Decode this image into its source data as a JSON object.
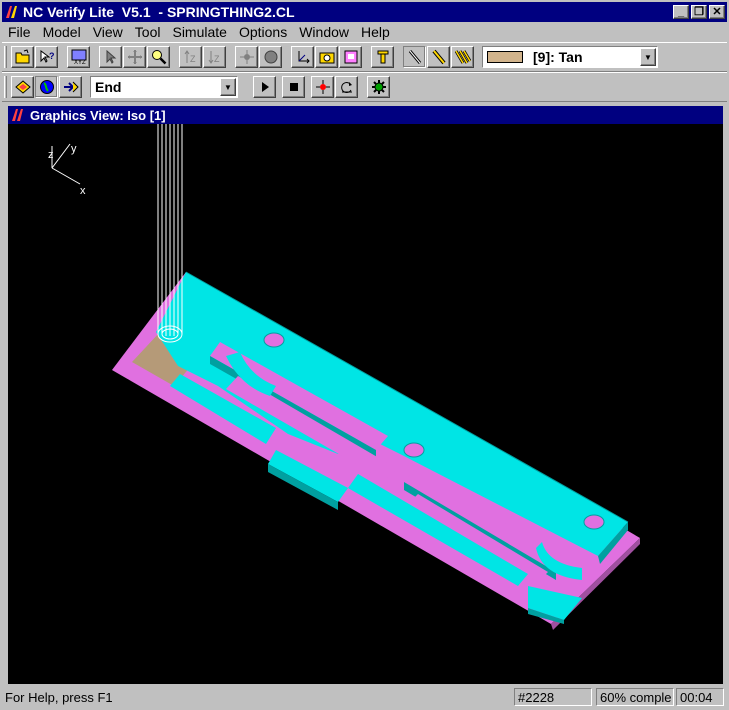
{
  "window": {
    "title": "NC Verify Lite  V5.1  - SPRINGTHING2.CL",
    "minimize": "_",
    "restore": "❐",
    "close": "✕"
  },
  "menu": [
    {
      "label": "File"
    },
    {
      "label": "Model"
    },
    {
      "label": "View"
    },
    {
      "label": "Tool"
    },
    {
      "label": "Simulate"
    },
    {
      "label": "Options"
    },
    {
      "label": "Window"
    },
    {
      "label": "Help"
    }
  ],
  "toolbar1": {
    "color_select": {
      "value": "[9]: Tan",
      "swatch": "#d2b48c"
    }
  },
  "toolbar2": {
    "end_select": {
      "value": "End"
    }
  },
  "graphics_view": {
    "title": "Graphics View: Iso [1]",
    "axes": {
      "z": "z",
      "y": "y",
      "x": "x"
    },
    "colors": {
      "background": "#000000",
      "top": "#00e5e5",
      "floor": "#e070e0",
      "shadow": "#00a0a0",
      "stock": "#b59a78"
    }
  },
  "status": {
    "help": "For Help, press F1",
    "record": "#2228",
    "progress": "60% comple",
    "time": "00:04"
  }
}
